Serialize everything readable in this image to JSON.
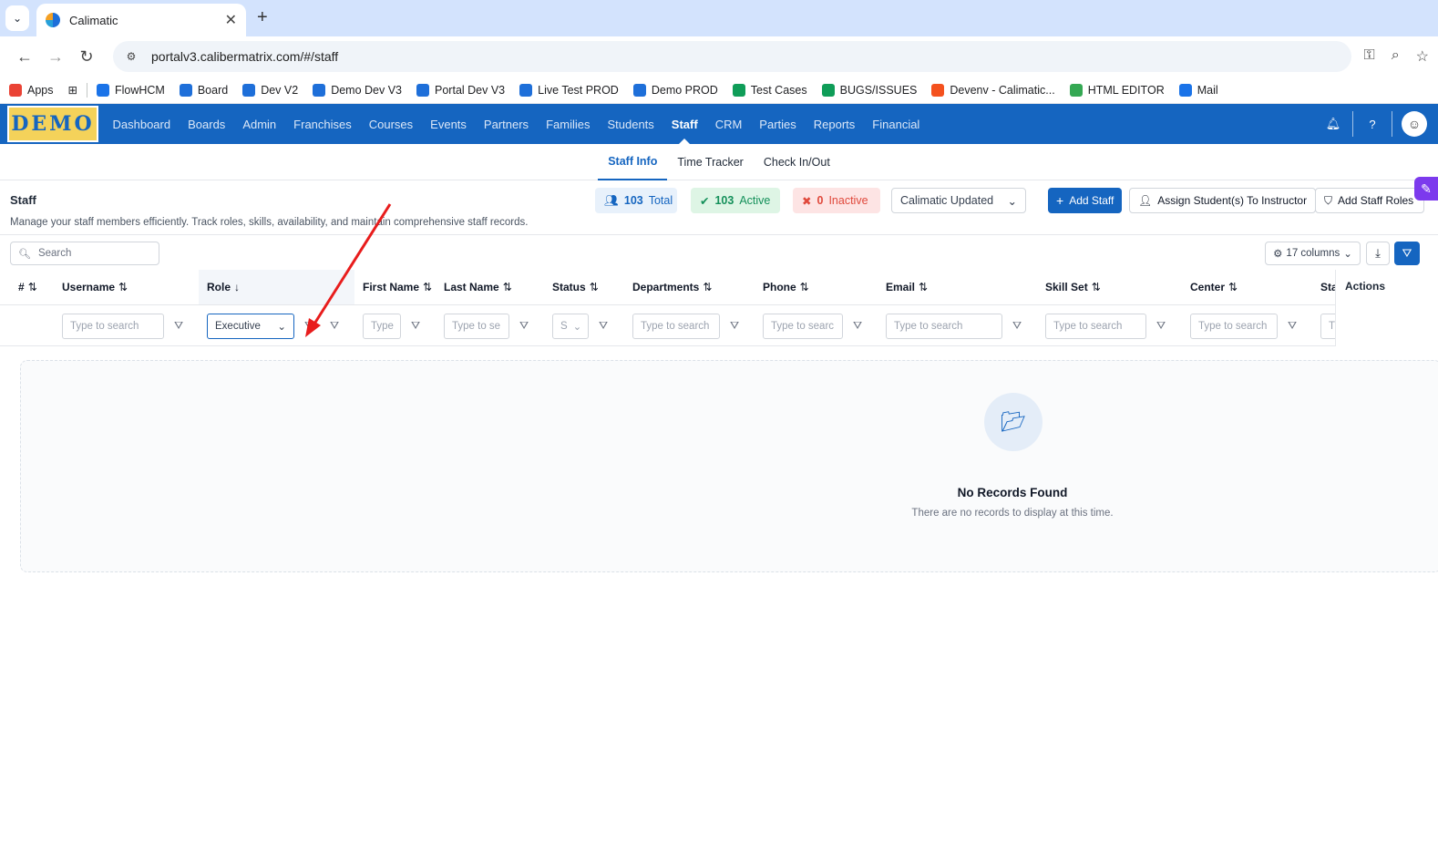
{
  "browser": {
    "tab_title": "Calimatic",
    "url": "portalv3.calibermatrix.com/#/staff",
    "bookmarks": [
      {
        "label": "Apps",
        "color": "#ea4335"
      },
      {
        "label": "FlowHCM",
        "color": "#1a73e8"
      },
      {
        "label": "Board",
        "color": "#1e6fd9"
      },
      {
        "label": "Dev V2",
        "color": "#1e6fd9"
      },
      {
        "label": "Demo Dev V3",
        "color": "#1e6fd9"
      },
      {
        "label": "Portal Dev V3",
        "color": "#1e6fd9"
      },
      {
        "label": "Live Test PROD",
        "color": "#1e6fd9"
      },
      {
        "label": "Demo PROD",
        "color": "#1e6fd9"
      },
      {
        "label": "Test Cases",
        "color": "#0f9d58"
      },
      {
        "label": "BUGS/ISSUES",
        "color": "#0f9d58"
      },
      {
        "label": "Devenv - Calimatic...",
        "color": "#f4511e"
      },
      {
        "label": "HTML EDITOR",
        "color": "#34a853"
      },
      {
        "label": "Mail",
        "color": "#1a73e8"
      }
    ]
  },
  "app": {
    "logo_text": "DEMO",
    "nav": [
      "Dashboard",
      "Boards",
      "Admin",
      "Franchises",
      "Courses",
      "Events",
      "Partners",
      "Families",
      "Students",
      "Staff",
      "CRM",
      "Parties",
      "Reports",
      "Financial"
    ],
    "active_nav": "Staff",
    "subtabs": [
      "Staff Info",
      "Time Tracker",
      "Check In/Out"
    ]
  },
  "page": {
    "title": "Staff",
    "description": "Manage your staff members efficiently. Track roles, skills, availability, and maintain comprehensive staff records.",
    "stats": {
      "total_num": "103",
      "total_label": "Total",
      "active_num": "103",
      "active_label": "Active",
      "inactive_num": "0",
      "inactive_label": "Inactive"
    },
    "center_select": "Calimatic Updated",
    "buttons": {
      "add_staff": "Add Staff",
      "assign": "Assign Student(s) To Instructor",
      "add_roles": "Add Staff Roles"
    }
  },
  "toolbar": {
    "search_placeholder": "Search",
    "columns_label": "17 columns"
  },
  "grid": {
    "headers": [
      "#",
      "Username",
      "Role",
      "First Name",
      "Last Name",
      "Status",
      "Departments",
      "Phone",
      "Email",
      "Skill Set",
      "Center",
      "Sta",
      "Actions"
    ],
    "filters": {
      "username": "Type to search",
      "role": "Executive",
      "first_name": "Type",
      "last_name": "Type to se",
      "status": "S",
      "departments": "Type to search",
      "phone": "Type to searc",
      "email": "Type to search",
      "skill_set": "Type to search",
      "center": "Type to search",
      "sta": "T"
    }
  },
  "empty_state": {
    "title": "No Records Found",
    "subtitle": "There are no records to display at this time."
  },
  "colors": {
    "brand": "#1565c0",
    "annotation_arrow": "#e81c1c"
  }
}
